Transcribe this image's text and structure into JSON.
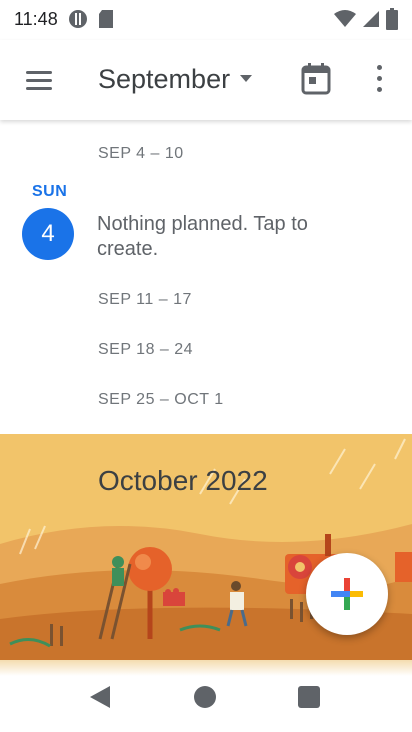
{
  "status_bar": {
    "time": "11:48"
  },
  "app_bar": {
    "month": "September"
  },
  "schedule": {
    "week_1": "SEP 4 – 10",
    "day_name": "SUN",
    "day_number": "4",
    "empty_text": "Nothing planned. Tap to create.",
    "week_2": "SEP 11 – 17",
    "week_3": "SEP 18 – 24",
    "week_4": "SEP 25 – OCT 1"
  },
  "banner": {
    "title": "October 2022"
  },
  "colors": {
    "accent": "#1a73e8",
    "banner_bg": "#f2c46a"
  },
  "icons": {
    "menu": "hamburger-icon",
    "dropdown": "triangle-down-icon",
    "today": "calendar-today-icon",
    "more": "vertical-dots-icon",
    "create": "plus-icon"
  }
}
